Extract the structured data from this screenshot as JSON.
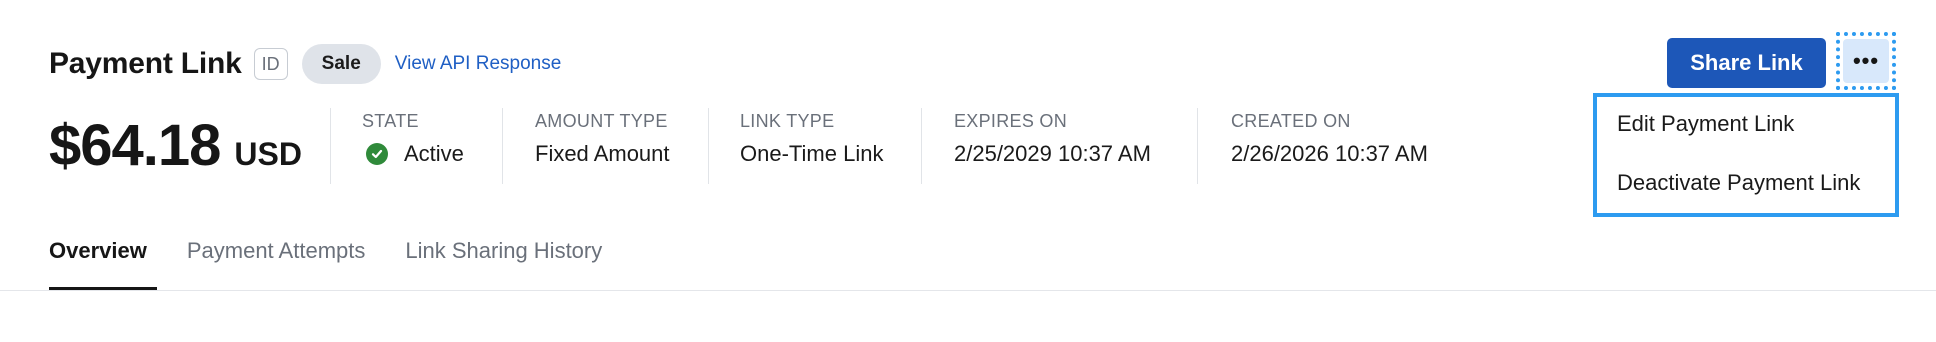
{
  "header": {
    "title": "Payment Link",
    "id_chip": "ID",
    "badge": "Sale",
    "api_link": "View API Response"
  },
  "amount": {
    "value": "$64.18",
    "currency": "USD"
  },
  "meta": {
    "state": {
      "label": "STATE",
      "value": "Active",
      "status_color": "#2f8a3a"
    },
    "amount_type": {
      "label": "AMOUNT TYPE",
      "value": "Fixed Amount"
    },
    "link_type": {
      "label": "LINK TYPE",
      "value": "One-Time Link"
    },
    "expires_on": {
      "label": "EXPIRES ON",
      "value": "2/25/2029 10:37 AM"
    },
    "created_on": {
      "label": "CREATED ON",
      "value": "2/26/2026 10:37 AM"
    }
  },
  "actions": {
    "share_label": "Share Link",
    "more_label": "•••",
    "more_icon": "ellipsis-icon",
    "menu": [
      {
        "label": "Edit Payment Link"
      },
      {
        "label": "Deactivate Payment Link"
      }
    ]
  },
  "tabs": [
    {
      "label": "Overview",
      "active": true
    },
    {
      "label": "Payment Attempts",
      "active": false
    },
    {
      "label": "Link Sharing History",
      "active": false
    }
  ],
  "colors": {
    "primary": "#1d57b8",
    "link": "#1f5fc4",
    "focus": "#2d9bf0",
    "badge_bg": "#dfe3e9"
  }
}
